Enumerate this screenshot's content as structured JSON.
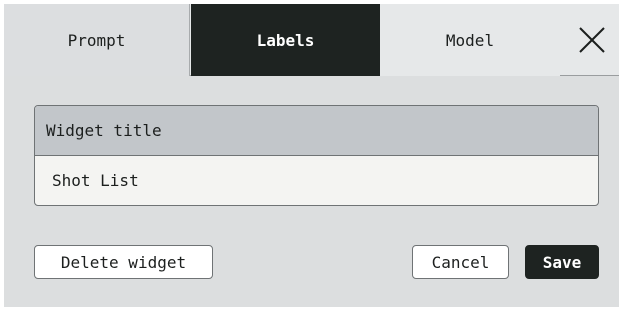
{
  "tabs": {
    "prompt": "Prompt",
    "labels": "Labels",
    "model": "Model",
    "active": "Labels"
  },
  "close_icon": "close-icon",
  "field": {
    "label": "Widget title",
    "value": "Shot List"
  },
  "buttons": {
    "delete": "Delete widget",
    "cancel": "Cancel",
    "save": "Save"
  },
  "colors": {
    "dark": "#1e2321",
    "panel": "#dcdedf",
    "field_header": "#c2c6ca",
    "field_body": "#f4f4f2"
  }
}
